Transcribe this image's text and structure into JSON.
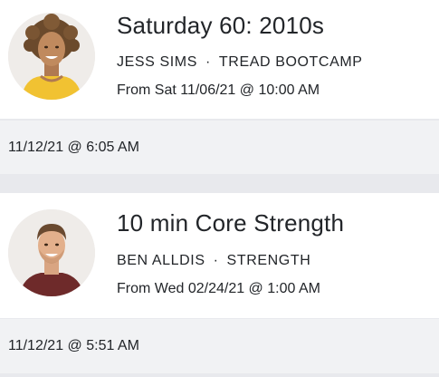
{
  "workouts": [
    {
      "title": "Saturday 60: 2010s",
      "instructor": "JESS SIMS",
      "separator": "·",
      "category": "TREAD BOOTCAMP",
      "scheduled": "From Sat 11/06/21 @ 10:00 AM",
      "completed_at": "11/12/21 @ 6:05 AM",
      "avatar_icon": "instructor-photo-icon"
    },
    {
      "title": "10 min Core Strength",
      "instructor": "BEN ALLDIS",
      "separator": "·",
      "category": "STRENGTH",
      "scheduled": "From Wed 02/24/21 @ 1:00 AM",
      "completed_at": "11/12/21 @ 5:51 AM",
      "avatar_icon": "instructor-photo-icon"
    }
  ],
  "colors": {
    "card_bg": "#ffffff",
    "date_row_bg": "#f1f2f4",
    "divider_bg": "#e8e9ed",
    "text": "#222529"
  }
}
